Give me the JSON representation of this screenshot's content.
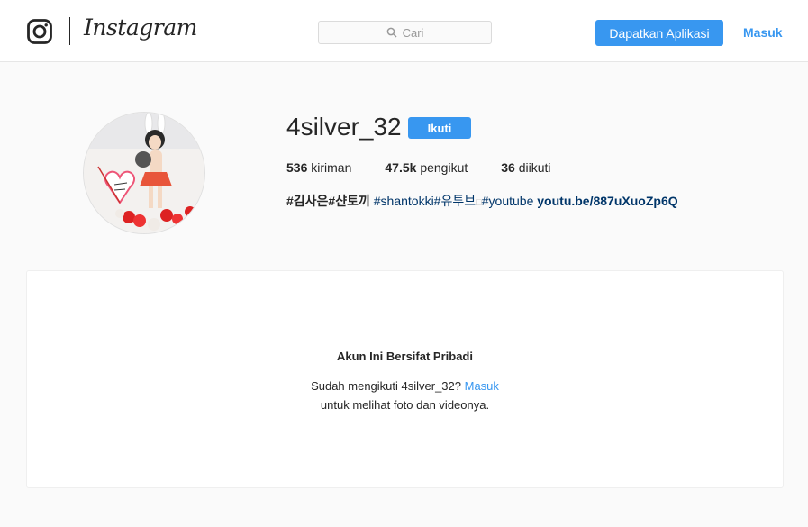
{
  "header": {
    "wordmark": "Instagram",
    "search_placeholder": "Cari",
    "get_app_label": "Dapatkan Aplikasi",
    "login_label": "Masuk"
  },
  "profile": {
    "username": "4silver_32",
    "follow_label": "Ikuti",
    "stats": {
      "posts_count": "536",
      "posts_label": "kiriman",
      "followers_count": "47.5k",
      "followers_label": "pengikut",
      "following_count": "36",
      "following_label": "diikuti"
    },
    "bio": {
      "strong": "#김사은#샨토끼",
      "tags": "#shantokki#유투브",
      "missing_glyph": "□",
      "tag_end": "#youtube",
      "link": "youtu.be/887uXuoZp6Q"
    }
  },
  "private_card": {
    "title": "Akun Ini Bersifat Pribadi",
    "line1_prefix": "Sudah mengikuti 4silver_32?",
    "line1_link": "Masuk",
    "line2": "untuk melihat foto dan videonya."
  },
  "colors": {
    "accent": "#3897f0",
    "link_dark": "#003569",
    "background": "#fafafa"
  }
}
